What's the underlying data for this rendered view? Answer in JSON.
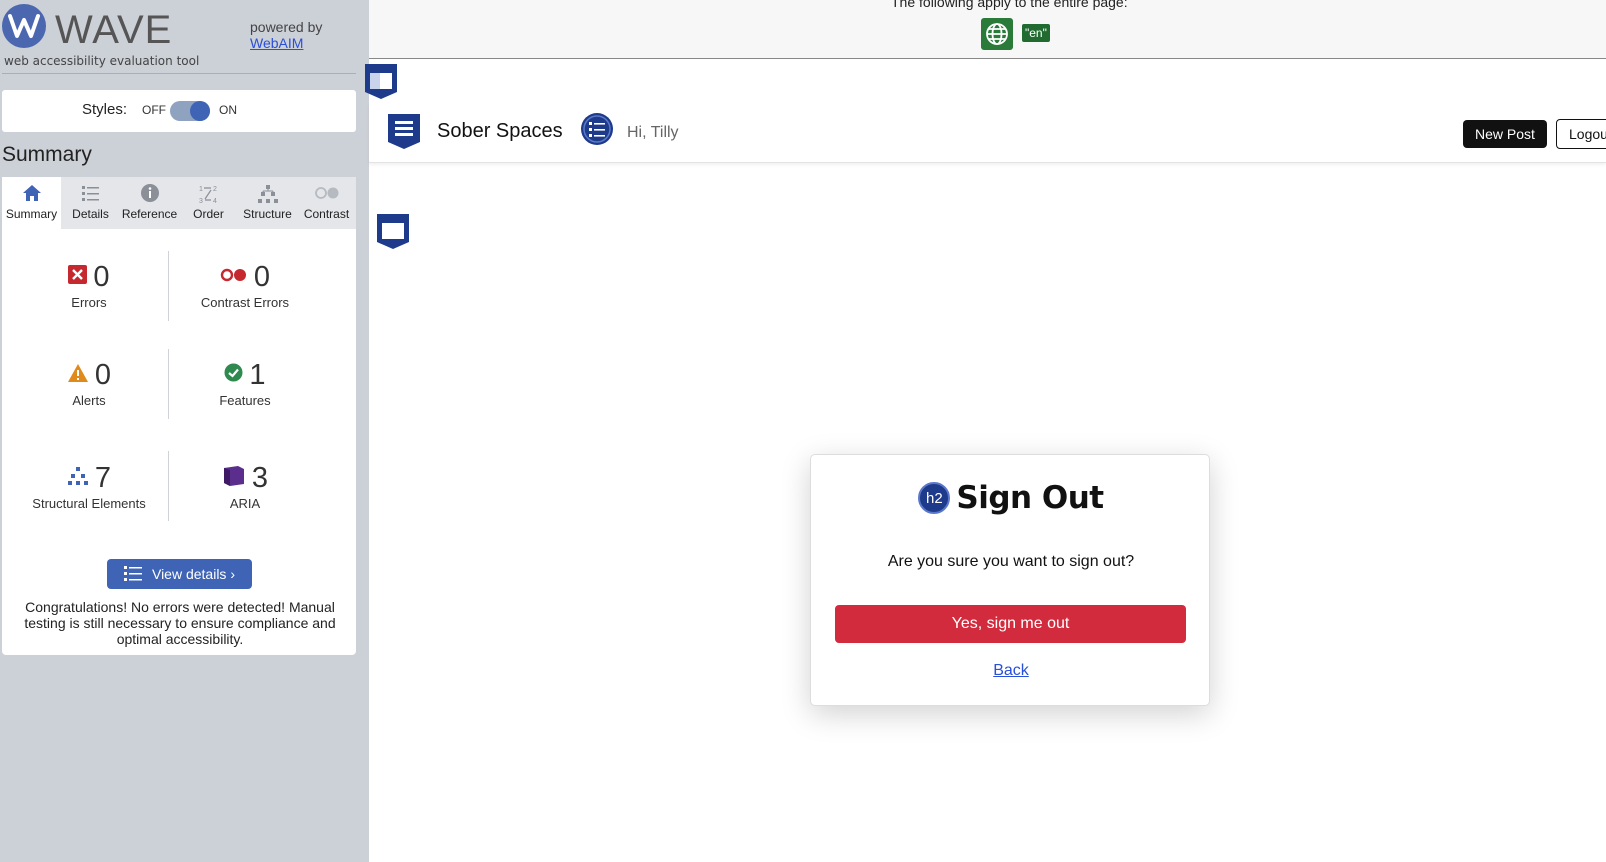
{
  "wave": {
    "title": "WAVE",
    "tagline": "web accessibility evaluation tool",
    "powered_by": "powered by",
    "powered_link": "WebAIM",
    "styles_label": "Styles:",
    "styles_off": "OFF",
    "styles_on": "ON",
    "summary_heading": "Summary",
    "tabs": [
      {
        "label": "Summary",
        "icon": "home-icon",
        "active": true
      },
      {
        "label": "Details",
        "icon": "list-icon"
      },
      {
        "label": "Reference",
        "icon": "info-icon"
      },
      {
        "label": "Order",
        "icon": "order-icon"
      },
      {
        "label": "Structure",
        "icon": "structure-icon"
      },
      {
        "label": "Contrast",
        "icon": "contrast-icon"
      }
    ],
    "stats": {
      "errors": {
        "value": "0",
        "label": "Errors"
      },
      "contrast_errors": {
        "value": "0",
        "label": "Contrast Errors"
      },
      "alerts": {
        "value": "0",
        "label": "Alerts"
      },
      "features": {
        "value": "1",
        "label": "Features"
      },
      "structural": {
        "value": "7",
        "label": "Structural Elements"
      },
      "aria": {
        "value": "3",
        "label": "ARIA"
      }
    },
    "view_details": "View details ›",
    "congrats": "Congratulations! No errors were detected! Manual testing is still necessary to ensure compliance and optimal accessibility."
  },
  "page": {
    "notice": "The following apply to the entire page:",
    "lang_badge": "\"en\"",
    "brand": "Sober Spaces",
    "greeting": "Hi, Tilly",
    "new_post": "New Post",
    "logout": "Logout",
    "modal": {
      "heading_badge": "h2",
      "title": "Sign Out",
      "question": "Are you sure you want to sign out?",
      "confirm": "Yes, sign me out",
      "back": "Back"
    }
  },
  "colors": {
    "sidebar_bg": "#ccd0d7",
    "wave_blue": "#3f64b5",
    "danger": "#d32b3e",
    "feature_green": "#2f8a4f",
    "alert_orange": "#e08a1b",
    "aria_purple": "#5b2d8c"
  }
}
